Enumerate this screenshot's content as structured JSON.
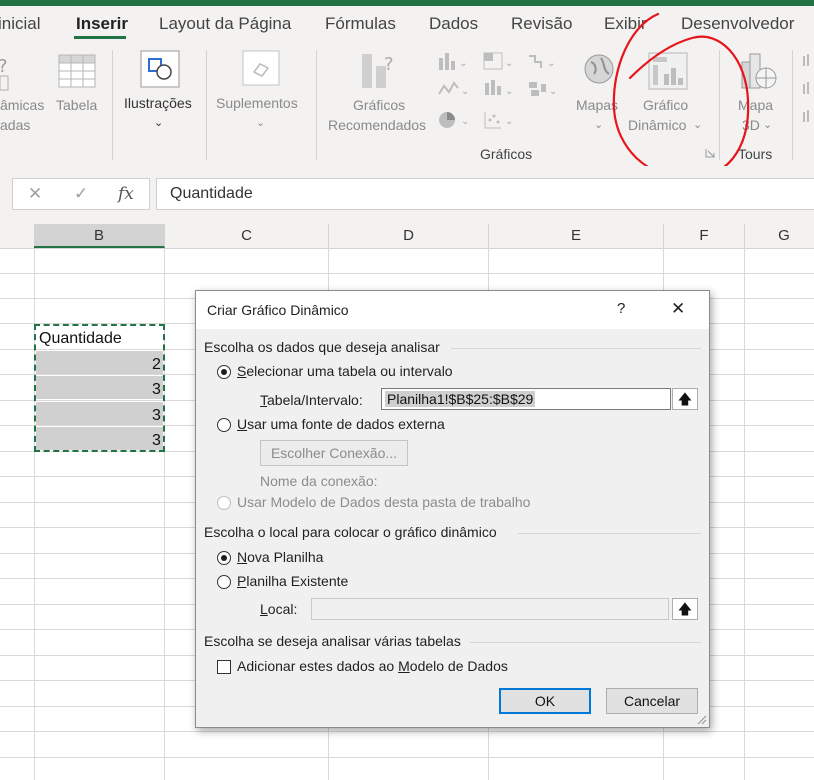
{
  "ribbon": {
    "tabs": [
      "inicial",
      "Inserir",
      "Layout da Página",
      "Fórmulas",
      "Dados",
      "Revisão",
      "Exibir",
      "Desenvolvedor"
    ],
    "active_tab": "Inserir",
    "pivot_partial_1": "âmicas",
    "pivot_partial_2": "adas",
    "tabela": "Tabela",
    "ilustracoes": "Ilustrações",
    "suplementos": "Suplementos",
    "graficos_rec_1": "Gráficos",
    "graficos_rec_2": "Recomendados",
    "mapas": "Mapas",
    "grafico_din_1": "Gráfico",
    "grafico_din_2": "Dinâmico",
    "mapa_1": "Mapa",
    "mapa_2": "3D",
    "group_graficos": "Gráficos",
    "group_tours": "Tours",
    "annotation_color": "#e8141b"
  },
  "formula_bar": {
    "fx": "fx",
    "value": "Quantidade"
  },
  "grid": {
    "columns": [
      "B",
      "C",
      "D",
      "E",
      "F",
      "G"
    ],
    "header_cell": "Quantidade",
    "values": [
      "2",
      "3",
      "3",
      "3"
    ]
  },
  "dialog": {
    "title": "Criar Gráfico Dinâmico",
    "help": "?",
    "close": "✕",
    "section1": "Escolha os dados que deseja analisar",
    "opt_select_rest": "elecionar uma tabela ou intervalo",
    "opt_select_key": "S",
    "table_label_key": "T",
    "table_label_rest": "abela/Intervalo:",
    "table_value": "Planilha1!$B$25:$B$29",
    "opt_external_key": "U",
    "opt_external_rest": "sar uma fonte de dados externa",
    "choose_connection": "Escolher Conexão...",
    "connection_name": "Nome da conexão:",
    "opt_model": "Usar Modelo de Dados desta pasta de trabalho",
    "section2": "Escolha o local para colocar o gráfico dinâmico",
    "opt_new_key": "N",
    "opt_new_rest": "ova Planilha",
    "opt_existing_key": "P",
    "opt_existing_rest": "lanilha Existente",
    "local_key": "L",
    "local_rest": "ocal:",
    "section3": "Escolha se deseja analisar várias tabelas",
    "add_model_1": "Adicionar estes dados ao ",
    "add_model_key": "M",
    "add_model_2": "odelo de Dados",
    "ok": "OK",
    "cancel": "Cancelar",
    "collapse_glyph": "🡅"
  }
}
